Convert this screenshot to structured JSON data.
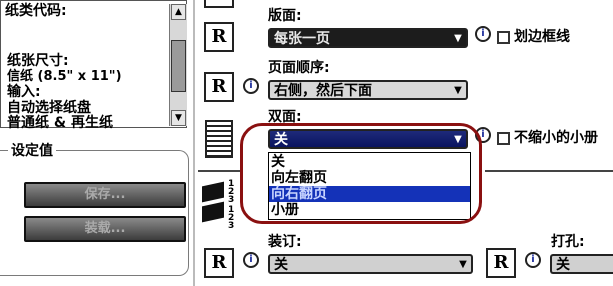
{
  "info_panel": {
    "lines": [
      "纸类代码:",
      "纸张尺寸:",
      "信纸 (8.5\" x 11\")",
      "输入:",
      "自动选择纸盘",
      "普通纸 & 再生纸"
    ]
  },
  "settings_group": {
    "title": "设定值",
    "save_label": "保存...",
    "load_label": "装载..."
  },
  "layout": {
    "pages_label": "版面:",
    "pages_value": "每张一页",
    "border_label": "划边框线",
    "order_label": "页面顺序:",
    "order_value": "右侧，然后下面",
    "duplex_label": "双面:",
    "duplex_value": "关",
    "shrink_label": "不缩小的小册",
    "duplex_options": [
      "关",
      "向左翻页",
      "向右翻页",
      "小册"
    ],
    "duplex_highlighted": "向右翻页",
    "binding_label": "装订:",
    "binding_value": "关",
    "punch_label": "打孔:",
    "punch_value": "关",
    "preview_letter": "R",
    "info_glyph": "i"
  },
  "icons": [
    "preview-r-icon",
    "info-balloon-icon",
    "checkbox-icon",
    "dropdown-arrow-icon",
    "duplex-pages-icon",
    "stacked-pages-icon",
    "scroll-up-icon",
    "scroll-down-icon"
  ],
  "colors": {
    "highlight": "#1432b8",
    "annotation_oval": "#8a1010",
    "dark_combo": "#1c1c1c"
  }
}
